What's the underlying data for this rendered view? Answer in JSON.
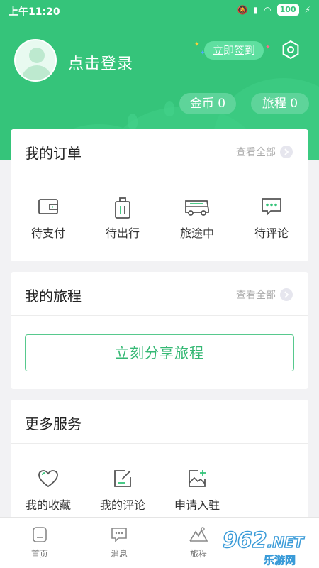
{
  "status": {
    "time": "上午11:20",
    "battery": "100"
  },
  "header": {
    "login_text": "点击登录",
    "checkin_label": "立即签到",
    "coins_label": "金币",
    "coins_value": "0",
    "trips_label": "旅程",
    "trips_value": "0"
  },
  "orders": {
    "title": "我的订单",
    "view_all": "查看全部",
    "items": [
      {
        "label": "待支付",
        "icon": "wallet-icon"
      },
      {
        "label": "待出行",
        "icon": "luggage-icon"
      },
      {
        "label": "旅途中",
        "icon": "bus-icon"
      },
      {
        "label": "待评论",
        "icon": "comment-icon"
      }
    ]
  },
  "trips": {
    "title": "我的旅程",
    "view_all": "查看全部",
    "share_button": "立刻分享旅程"
  },
  "services": {
    "title": "更多服务",
    "items": [
      {
        "label": "我的收藏",
        "icon": "heart-icon"
      },
      {
        "label": "我的评论",
        "icon": "edit-icon"
      },
      {
        "label": "申请入驻",
        "icon": "image-add-icon"
      }
    ]
  },
  "tabbar": {
    "items": [
      {
        "label": "首页",
        "icon": "home-icon"
      },
      {
        "label": "消息",
        "icon": "message-icon"
      },
      {
        "label": "旅程",
        "icon": "mountain-icon"
      }
    ]
  },
  "watermark": {
    "number": "962",
    "suffix": ".NET",
    "sub": "乐游网"
  },
  "colors": {
    "brand": "#35c47a",
    "accent_text": "#35b874"
  }
}
